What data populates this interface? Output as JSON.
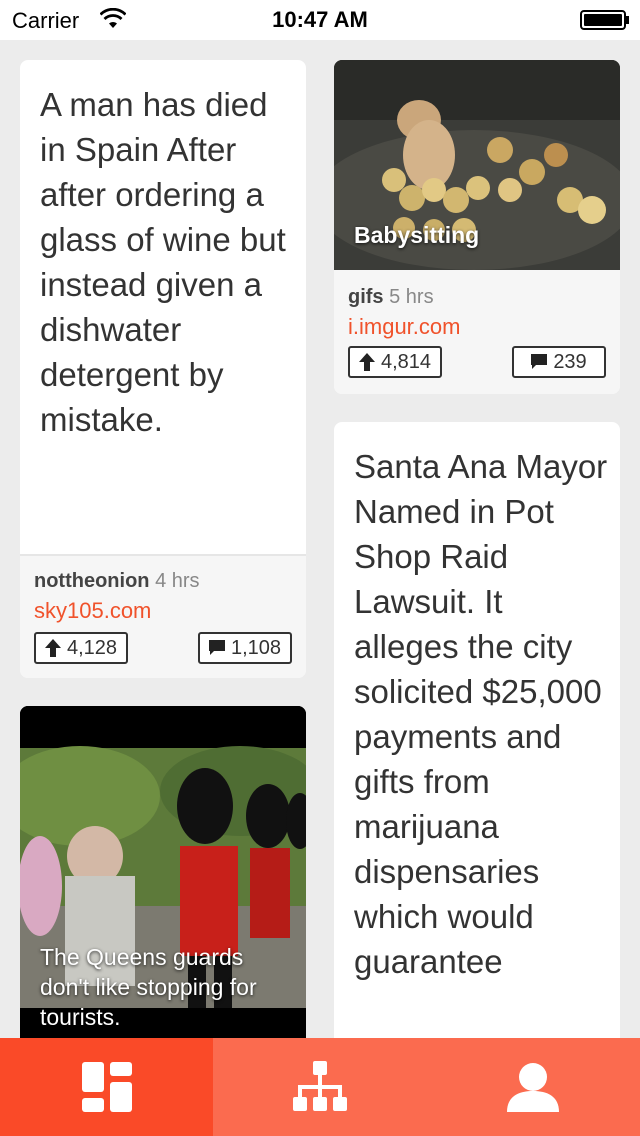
{
  "status_bar": {
    "carrier": "Carrier",
    "time": "10:47 AM"
  },
  "cards": {
    "spain": {
      "title": "A man has died in Spain After after ordering a glass of wine but instead given a dishwater detergent by mistake.",
      "subreddit": "nottheonion",
      "age": "4 hrs",
      "domain": "sky105.com",
      "upvotes": "4,128",
      "comments": "1,108"
    },
    "babysitting": {
      "caption": "Babysitting",
      "subreddit": "gifs",
      "age": "5 hrs",
      "domain": "i.imgur.com",
      "upvotes": "4,814",
      "comments": "239"
    },
    "guards": {
      "caption": "The Queens guards don't like stopping for tourists."
    },
    "santa_ana": {
      "title": "Santa Ana Mayor Named in Pot Shop Raid Lawsuit. It alleges the city solicited $25,000 payments and gifts from marijuana dispensaries which would guarantee"
    }
  },
  "tab_bar": {
    "tabs": [
      {
        "icon": "dashboard-icon",
        "active": true
      },
      {
        "icon": "hierarchy-icon",
        "active": false
      },
      {
        "icon": "user-icon",
        "active": false
      }
    ]
  },
  "colors": {
    "accent": "#f0522b",
    "tab_active": "#fa4a28",
    "tab_bg": "#fb6b4f"
  }
}
